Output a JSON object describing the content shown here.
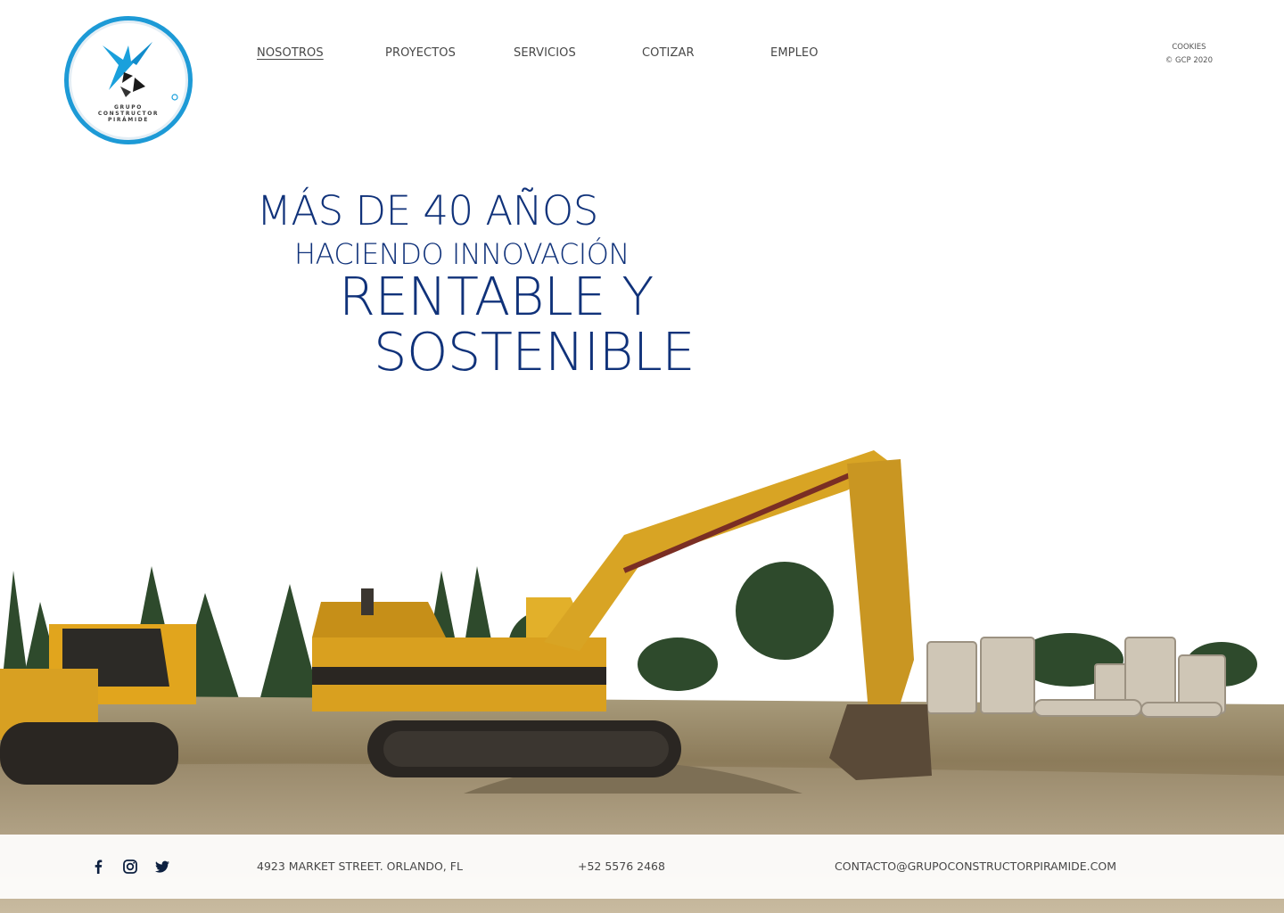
{
  "brand": {
    "logo_lines": [
      "GRUPO",
      "CONSTRUCTOR",
      "PIRÁMIDE"
    ],
    "accent_color": "#1d9ad6",
    "headline_color": "#10327a"
  },
  "nav": {
    "items": [
      {
        "label": "NOSOTROS",
        "active": true
      },
      {
        "label": "PROYECTOS",
        "active": false
      },
      {
        "label": "SERVICIOS",
        "active": false
      },
      {
        "label": "COTIZAR",
        "active": false
      },
      {
        "label": "EMPLEO",
        "active": false
      }
    ]
  },
  "meta": {
    "cookies": "COOKIES",
    "copyright": "© GCP 2020"
  },
  "hero": {
    "line1": "MÁS DE 40 AÑOS",
    "line2": "HACIENDO INNOVACIÓN",
    "line3": "RENTABLE Y",
    "line4": "SOSTENIBLE",
    "image_icon": "excavator-construction-site-photo"
  },
  "footer": {
    "social_icons": [
      "facebook-icon",
      "instagram-icon",
      "twitter-icon"
    ],
    "address": "4923 MARKET STREET. ORLANDO, FL",
    "phone": "+52 5576 2468",
    "email": "CONTACTO@GRUPOCONSTRUCTORPIRAMIDE.COM"
  }
}
